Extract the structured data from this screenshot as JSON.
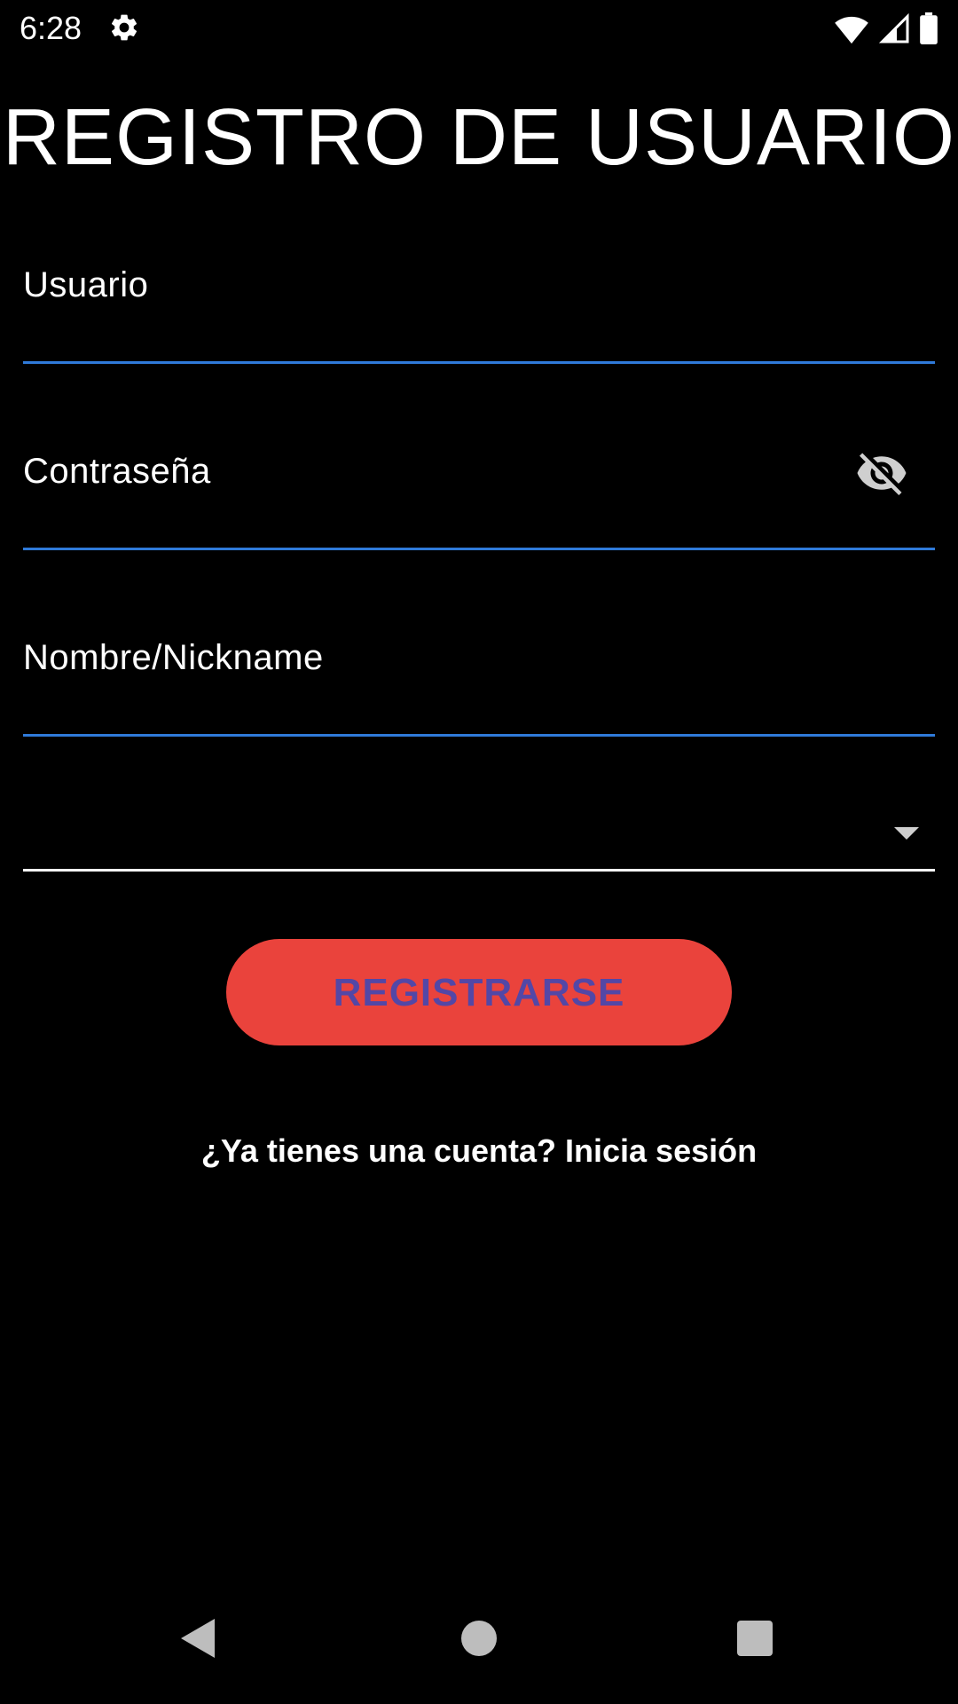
{
  "status_bar": {
    "time": "6:28",
    "icons": [
      "gear-icon",
      "wifi-icon",
      "signal-icon",
      "battery-icon"
    ]
  },
  "title": "REGISTRO DE USUARIO",
  "form": {
    "username": {
      "label": "Usuario",
      "value": ""
    },
    "password": {
      "label": "Contraseña",
      "value": "",
      "toggle_icon": "eye-off-icon"
    },
    "nickname": {
      "label": "Nombre/Nickname",
      "value": ""
    },
    "dropdown": {
      "selected": "",
      "icon": "arrow-drop-down-icon"
    }
  },
  "register_button": {
    "label": "REGISTRARSE"
  },
  "login_link": {
    "text": "¿Ya tienes una cuenta? Inicia sesión"
  },
  "nav_bar": {
    "icons": [
      "back-icon",
      "home-icon",
      "recents-icon"
    ]
  },
  "colors": {
    "background": "#000000",
    "field_underline": "#2f7ad9",
    "button_background": "#ea433c",
    "button_text": "#5347a6"
  }
}
